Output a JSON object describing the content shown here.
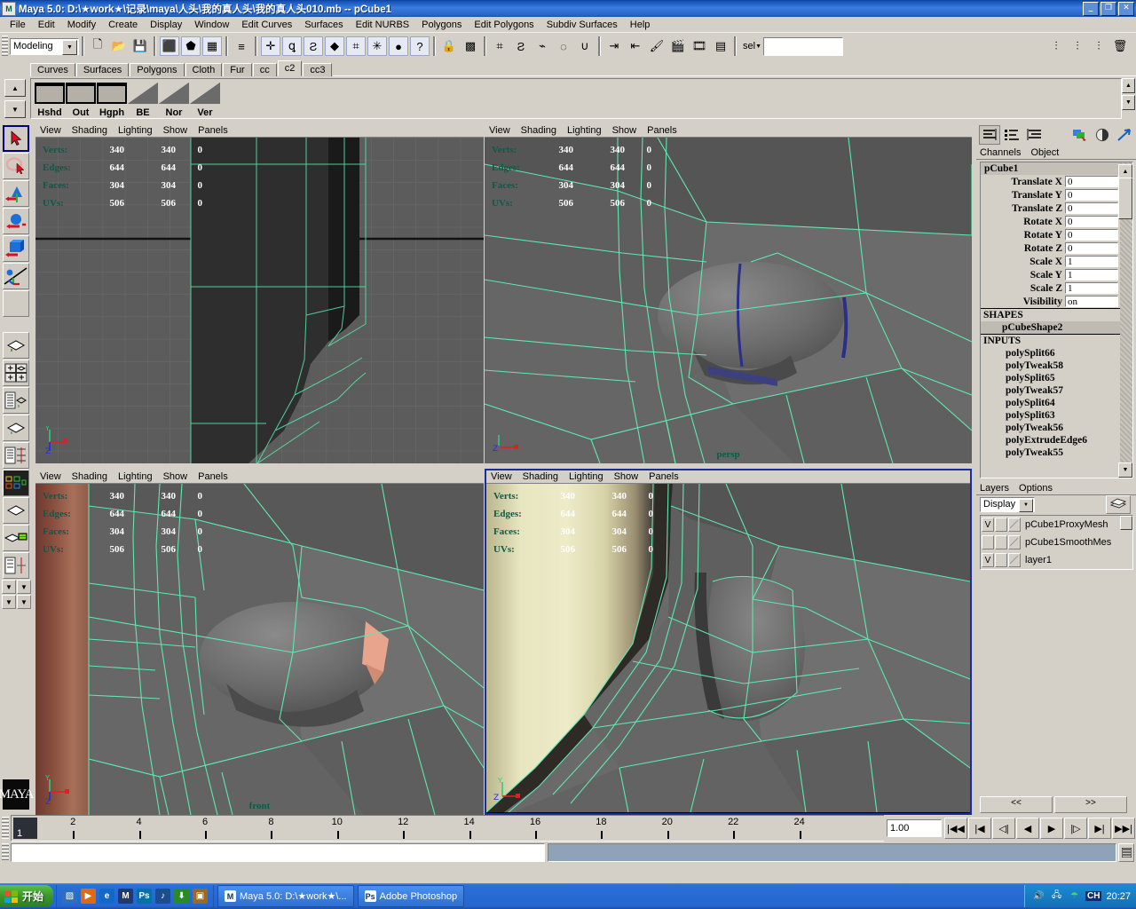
{
  "window": {
    "title": "Maya 5.0: D:\\★work★\\记录\\maya\\人头\\我的真人头\\我的真人头010.mb  --  pCube1",
    "icon": "maya-icon",
    "minimize": "_",
    "maximize": "❐",
    "close": "✕"
  },
  "menubar": {
    "items": [
      "File",
      "Edit",
      "Modify",
      "Create",
      "Display",
      "Window",
      "Edit Curves",
      "Surfaces",
      "Edit NURBS",
      "Polygons",
      "Edit Polygons",
      "Subdiv Surfaces",
      "Help"
    ]
  },
  "statusbar": {
    "menuset": "Modeling",
    "menuset_arrow": "▼",
    "selection_mode_label": "sel",
    "selection_mode_arrow": "▼",
    "selection_field_value": "",
    "buttons": [
      {
        "name": "new-scene-icon",
        "glyph": "🗋"
      },
      {
        "name": "open-scene-icon",
        "glyph": "📂"
      },
      {
        "name": "save-scene-icon",
        "glyph": "💾"
      },
      {
        "name": "select-by-hierarchy-icon",
        "glyph": "⬛"
      },
      {
        "name": "select-by-object-type-icon",
        "glyph": "⬟"
      },
      {
        "name": "select-by-component-type-icon",
        "glyph": "▦"
      },
      {
        "name": "component-mask-icon",
        "glyph": "≡"
      },
      {
        "name": "handles-mask-icon",
        "glyph": "✛"
      },
      {
        "name": "curves-mask-icon",
        "glyph": "ꝗ"
      },
      {
        "name": "surfaces-mask-icon",
        "glyph": "Ƨ"
      },
      {
        "name": "polygons-mask-icon",
        "glyph": "◆"
      },
      {
        "name": "lattices-mask-icon",
        "glyph": "⌗"
      },
      {
        "name": "particles-mask-icon",
        "glyph": "✳"
      },
      {
        "name": "nurbs-mask-icon",
        "glyph": "●"
      },
      {
        "name": "misc-mask-icon",
        "glyph": "?"
      },
      {
        "name": "lock-selection-icon",
        "glyph": "🔒"
      },
      {
        "name": "highlight-selection-icon",
        "glyph": "▩"
      },
      {
        "name": "snap-to-grid-icon",
        "glyph": "⌗"
      },
      {
        "name": "snap-to-curve-icon",
        "glyph": "Ƨ"
      },
      {
        "name": "snap-to-point-icon",
        "glyph": "⌁"
      },
      {
        "name": "snap-to-view-plane-icon",
        "glyph": "◌"
      },
      {
        "name": "magnet-snap-icon",
        "glyph": "∪"
      },
      {
        "name": "construction-history-in-icon",
        "glyph": "⇥"
      },
      {
        "name": "construction-history-out-icon",
        "glyph": "⇤"
      },
      {
        "name": "render-current-frame-icon",
        "glyph": "🖌"
      },
      {
        "name": "ipr-render-icon",
        "glyph": "🎬"
      },
      {
        "name": "render-globals-icon",
        "glyph": "🎞"
      },
      {
        "name": "render-view-icon",
        "glyph": "▤"
      }
    ],
    "right_buttons": [
      {
        "name": "show-attribute-editor-icon",
        "glyph": "⫶"
      },
      {
        "name": "show-tool-settings-icon",
        "glyph": "⫶"
      },
      {
        "name": "show-channel-box-icon",
        "glyph": "⫶"
      },
      {
        "name": "delete-icon",
        "glyph": "🗑"
      }
    ]
  },
  "shelf": {
    "tabs": [
      {
        "label": "Curves",
        "active": false
      },
      {
        "label": "Surfaces",
        "active": false
      },
      {
        "label": "Polygons",
        "active": false
      },
      {
        "label": "Cloth",
        "active": false
      },
      {
        "label": "Fur",
        "active": false
      },
      {
        "label": "cc",
        "active": false
      },
      {
        "label": "c2",
        "active": true
      },
      {
        "label": "cc3",
        "active": false
      }
    ],
    "items": [
      {
        "label": "Hshd",
        "style": "box"
      },
      {
        "label": "Out",
        "style": "box"
      },
      {
        "label": "Hgph",
        "style": "box"
      },
      {
        "label": "BE",
        "style": "tri"
      },
      {
        "label": "Nor",
        "style": "tri"
      },
      {
        "label": "Ver",
        "style": "tri"
      }
    ],
    "scroll_up": "▲",
    "scroll_down": "▼"
  },
  "toolbox": {
    "items": [
      {
        "name": "select-tool",
        "selected": true
      },
      {
        "name": "lasso-select-tool",
        "selected": false
      },
      {
        "name": "move-tool",
        "selected": false
      },
      {
        "name": "rotate-tool",
        "selected": false
      },
      {
        "name": "scale-tool",
        "selected": false
      },
      {
        "name": "show-manipulator-tool",
        "selected": false
      },
      {
        "name": "last-tool-used",
        "selected": false
      }
    ],
    "layouts": [
      {
        "name": "single-perspective-layout"
      },
      {
        "name": "four-view-layout"
      },
      {
        "name": "outliner-persp-layout"
      },
      {
        "name": "persp-graph-layout"
      },
      {
        "name": "hypergraph-layout"
      },
      {
        "name": "hypershade-persp-layout"
      },
      {
        "name": "outliner-graph-layout"
      }
    ],
    "logo": "MAYA"
  },
  "viewports": [
    {
      "id": "top-left",
      "name": "side-viewport",
      "menus": [
        "View",
        "Shading",
        "Lighting",
        "Show",
        "Panels"
      ],
      "label": "",
      "active": false,
      "hud": {
        "rows": [
          {
            "label": "Verts:",
            "a": "340",
            "b": "340",
            "c": "0"
          },
          {
            "label": "Edges:",
            "a": "644",
            "b": "644",
            "c": "0"
          },
          {
            "label": "Faces:",
            "a": "304",
            "b": "304",
            "c": "0"
          },
          {
            "label": "UVs:",
            "a": "506",
            "b": "506",
            "c": "0"
          }
        ]
      },
      "axis": {
        "up": "Y",
        "right": "X",
        "down": "Z"
      }
    },
    {
      "id": "top-right",
      "name": "persp-viewport",
      "menus": [
        "View",
        "Shading",
        "Lighting",
        "Show",
        "Panels"
      ],
      "label": "persp",
      "active": false,
      "hud": {
        "rows": [
          {
            "label": "Verts:",
            "a": "340",
            "b": "340",
            "c": "0"
          },
          {
            "label": "Edges:",
            "a": "644",
            "b": "644",
            "c": "0"
          },
          {
            "label": "Faces:",
            "a": "304",
            "b": "304",
            "c": "0"
          },
          {
            "label": "UVs:",
            "a": "506",
            "b": "506",
            "c": "0"
          }
        ]
      },
      "axis": {
        "up": "Y",
        "right": "X",
        "down": "Z"
      }
    },
    {
      "id": "bottom-left",
      "name": "front-viewport",
      "menus": [
        "View",
        "Shading",
        "Lighting",
        "Show",
        "Panels"
      ],
      "label": "front",
      "active": false,
      "hud": {
        "rows": [
          {
            "label": "Verts:",
            "a": "340",
            "b": "340",
            "c": "0"
          },
          {
            "label": "Edges:",
            "a": "644",
            "b": "644",
            "c": "0"
          },
          {
            "label": "Faces:",
            "a": "304",
            "b": "304",
            "c": "0"
          },
          {
            "label": "UVs:",
            "a": "506",
            "b": "506",
            "c": "0"
          }
        ]
      },
      "axis": {
        "up": "Y",
        "right": "X",
        "down": "Z"
      }
    },
    {
      "id": "bottom-right",
      "name": "side-detail-viewport",
      "menus": [
        "View",
        "Shading",
        "Lighting",
        "Show",
        "Panels"
      ],
      "label": "",
      "active": true,
      "hud": {
        "rows": [
          {
            "label": "Verts:",
            "a": "340",
            "b": "340",
            "c": "0"
          },
          {
            "label": "Edges:",
            "a": "644",
            "b": "644",
            "c": "0"
          },
          {
            "label": "Faces:",
            "a": "304",
            "b": "304",
            "c": "0"
          },
          {
            "label": "UVs:",
            "a": "506",
            "b": "506",
            "c": "0"
          }
        ]
      },
      "axis": {
        "up": "Y",
        "right": "X",
        "down": "Z"
      }
    }
  ],
  "channelbox": {
    "toolbar": [
      {
        "name": "show-channel-box-icon",
        "active": true
      },
      {
        "name": "show-channel-box-layer-editor-icon",
        "active": false
      },
      {
        "name": "show-layer-editor-icon",
        "active": false
      },
      {
        "name": "attribute-editor-icon",
        "active": false
      },
      {
        "name": "tool-settings-icon",
        "active": false
      },
      {
        "name": "channel-box-arrow-icon",
        "active": false
      }
    ],
    "menus": [
      "Channels",
      "Object"
    ],
    "node_name": "pCube1",
    "channels": [
      {
        "name": "Translate X",
        "value": "0"
      },
      {
        "name": "Translate Y",
        "value": "0"
      },
      {
        "name": "Translate Z",
        "value": "0"
      },
      {
        "name": "Rotate X",
        "value": "0"
      },
      {
        "name": "Rotate Y",
        "value": "0"
      },
      {
        "name": "Rotate Z",
        "value": "0"
      },
      {
        "name": "Scale X",
        "value": "1"
      },
      {
        "name": "Scale Y",
        "value": "1"
      },
      {
        "name": "Scale Z",
        "value": "1"
      },
      {
        "name": "Visibility",
        "value": "on"
      }
    ],
    "shapes_header": "SHAPES",
    "shapes": [
      "pCubeShape2"
    ],
    "inputs_header": "INPUTS",
    "inputs": [
      "polySplit66",
      "polyTweak58",
      "polySplit65",
      "polyTweak57",
      "polySplit64",
      "polySplit63",
      "polyTweak56",
      "polyExtrudeEdge6",
      "polyTweak55"
    ],
    "scroll_up": "▲",
    "scroll_down": "▼"
  },
  "layers": {
    "menus": [
      "Layers",
      "Options"
    ],
    "display_mode": "Display",
    "dropdown_arrow": "▼",
    "sort_icon": "layer-sort-icon",
    "rows": [
      {
        "visible": "V",
        "playback": "",
        "type": "",
        "name": "pCube1ProxyMesh"
      },
      {
        "visible": "",
        "playback": "",
        "type": "",
        "name": "pCube1SmoothMes"
      },
      {
        "visible": "V",
        "playback": "",
        "type": "",
        "name": "layer1"
      }
    ],
    "nav_prev": "<<",
    "nav_next": ">>"
  },
  "timeline": {
    "current_frame": "1",
    "ticks": [
      2,
      4,
      6,
      8,
      10,
      12,
      14,
      16,
      18,
      20,
      22,
      24
    ],
    "playback_speed": "1.00",
    "transport": [
      {
        "name": "go-to-start-button",
        "glyph": "|◀◀"
      },
      {
        "name": "step-back-keyframe-button",
        "glyph": "|◀"
      },
      {
        "name": "step-back-frame-button",
        "glyph": "◁|"
      },
      {
        "name": "play-backwards-button",
        "glyph": "◀"
      },
      {
        "name": "play-forwards-button",
        "glyph": "▶"
      },
      {
        "name": "step-forward-frame-button",
        "glyph": "|▷"
      },
      {
        "name": "step-forward-keyframe-button",
        "glyph": "▶|"
      },
      {
        "name": "go-to-end-button",
        "glyph": "▶▶|"
      }
    ],
    "range_end_icon": "range-options-icon"
  },
  "taskbar": {
    "start_label": "开始",
    "quick_launch": [
      {
        "name": "show-desktop-icon",
        "glyph": "▨",
        "color": "#2b6fc4"
      },
      {
        "name": "media-player-icon",
        "glyph": "▶",
        "color": "#e06a10"
      },
      {
        "name": "internet-explorer-icon",
        "glyph": "e",
        "color": "#1268c8"
      },
      {
        "name": "maya-icon",
        "glyph": "M",
        "color": "#203a6c"
      },
      {
        "name": "photoshop-icon",
        "glyph": "Ps",
        "color": "#0a6fa8"
      },
      {
        "name": "winamp-icon",
        "glyph": "♪",
        "color": "#1c4d8c"
      },
      {
        "name": "download-icon",
        "glyph": "⬇",
        "color": "#2a8a2a"
      },
      {
        "name": "folder-icon",
        "glyph": "▣",
        "color": "#9a6a20"
      }
    ],
    "tasks": [
      {
        "name": "task-maya",
        "icon": "maya-icon",
        "label": "Maya 5.0: D:\\★work★\\...",
        "active": true
      },
      {
        "name": "task-photoshop",
        "icon": "photoshop-icon",
        "label": "Adobe Photoshop",
        "active": false
      }
    ],
    "tray": [
      {
        "name": "volume-icon",
        "glyph": "🔊"
      },
      {
        "name": "network-icon",
        "glyph": "🖧"
      },
      {
        "name": "umbrella-icon",
        "glyph": "☂"
      },
      {
        "name": "ime-indicator",
        "glyph": "CH"
      }
    ],
    "clock": "20:27"
  }
}
